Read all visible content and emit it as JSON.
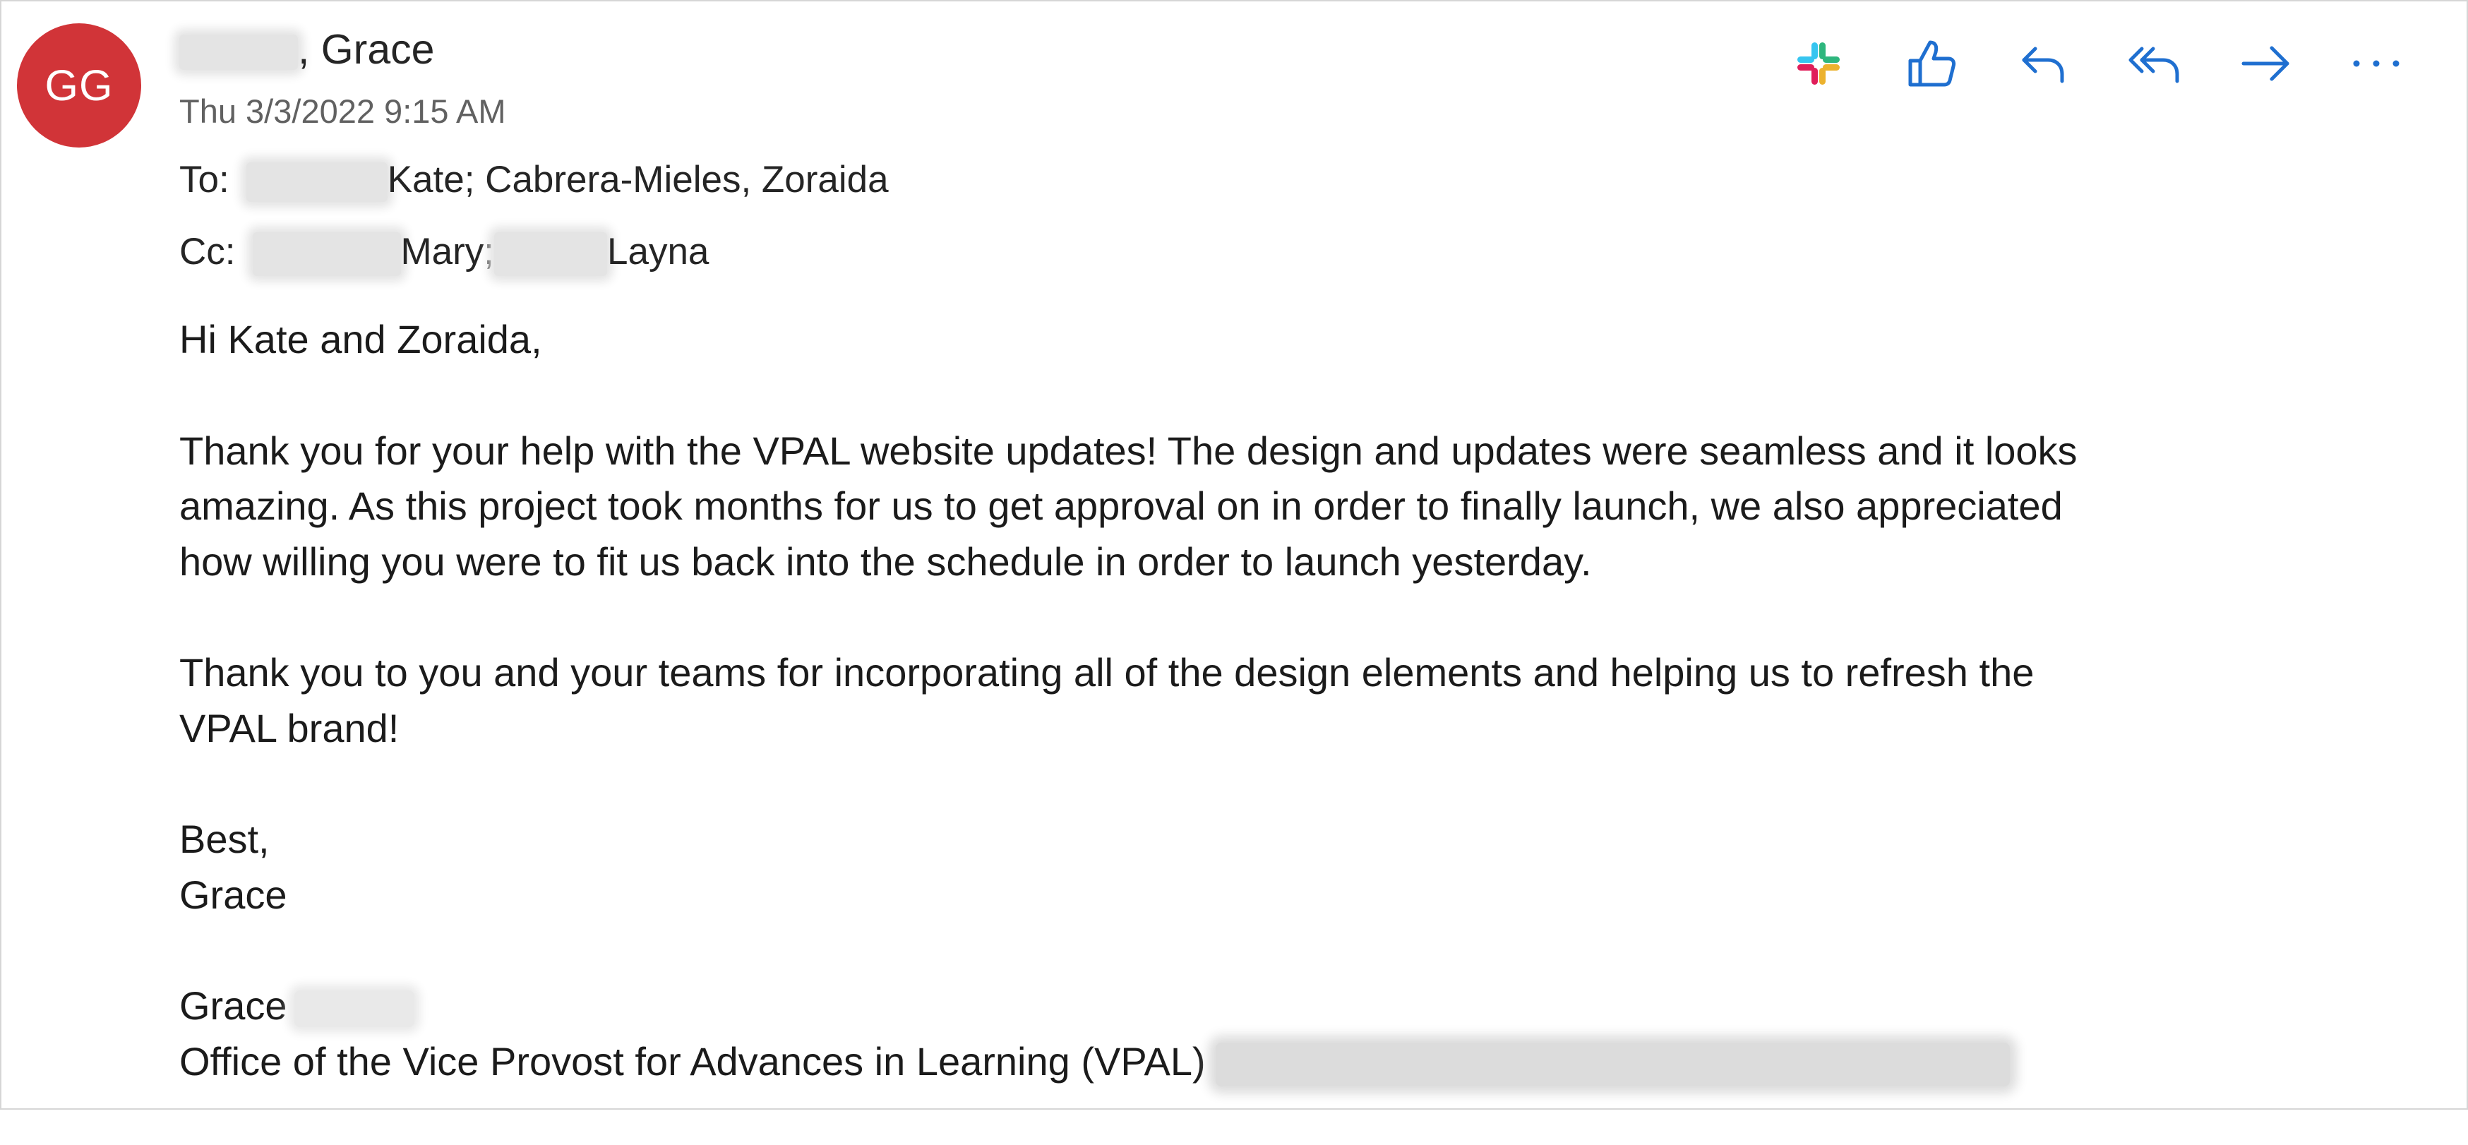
{
  "message": {
    "avatar_initials": "GG",
    "sender_name_suffix": ", Grace",
    "date": "Thu 3/3/2022 9:15 AM",
    "to": {
      "label": "To:",
      "rest": "Kate; Cabrera-Mieles, Zoraida"
    },
    "cc": {
      "label": "Cc:",
      "part1": "Mary;",
      "part2": "Layna"
    }
  },
  "toolbar": {
    "icons": [
      "slack-icon",
      "like-icon",
      "reply-icon",
      "reply-all-icon",
      "forward-icon",
      "more-icon"
    ]
  },
  "body": {
    "greeting": "Hi Kate and Zoraida,",
    "para1_lines": [
      "Thank you for your help with the VPAL website updates! The design and updates were seamless and it looks",
      "amazing. As this project took months for us to get approval on in order to finally launch, we also appreciated",
      "how willing you were to fit us back into the schedule in order to launch yesterday."
    ],
    "para2_lines": [
      "Thank you to you and your teams for incorporating all of the design elements and helping us to refresh the",
      "VPAL brand!"
    ],
    "closing": "Best,",
    "closing_name": "Grace",
    "signature_name": "Grace",
    "signature_office": "Office of the Vice Provost for Advances in Learning (VPAL)"
  },
  "colors": {
    "avatar_bg": "#d13438",
    "toolbar_icon": "#1f6fd0"
  }
}
